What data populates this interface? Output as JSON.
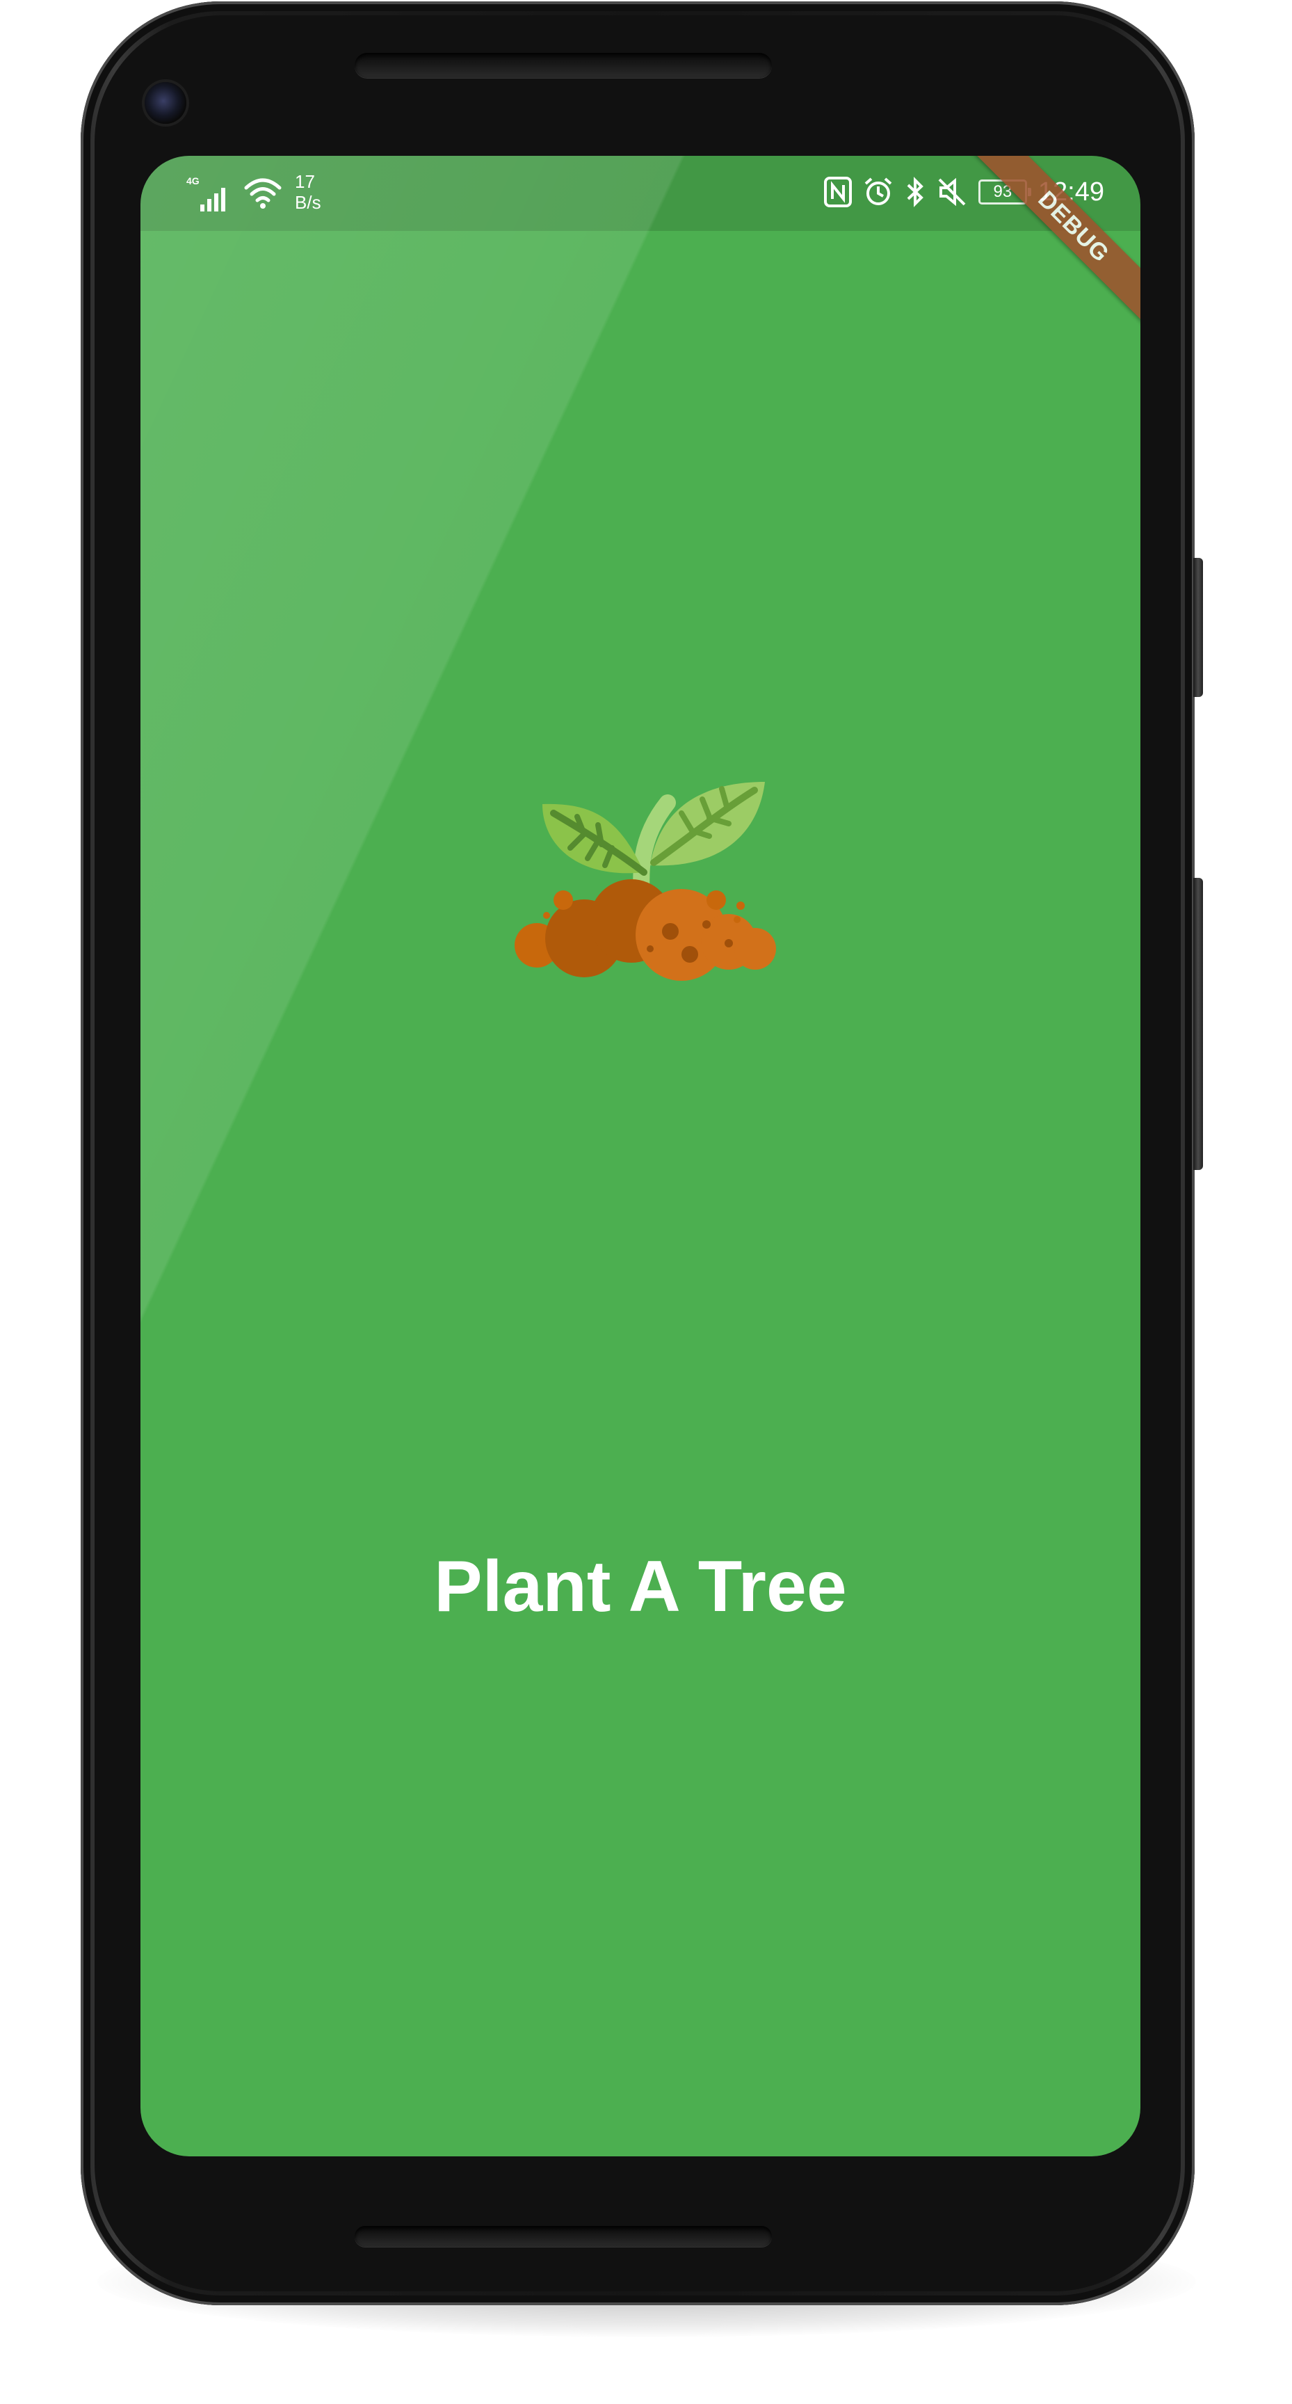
{
  "status_bar": {
    "network_type": "4G",
    "data_speed_value": "17",
    "data_speed_unit": "B/s",
    "battery_level": "93",
    "time": "12:49"
  },
  "debug_banner": {
    "label": "DEBUG"
  },
  "splash": {
    "logo_icon": "sprout-in-soil-icon",
    "title": "Plant A Tree"
  },
  "colors": {
    "background": "#4caf50",
    "title_text": "#ffffff",
    "leaf_light": "#8bc34a",
    "leaf_dark": "#558b2f",
    "soil": "#c8680c",
    "soil_dark": "#b05a0a",
    "debug_banner": "#a0522d"
  }
}
